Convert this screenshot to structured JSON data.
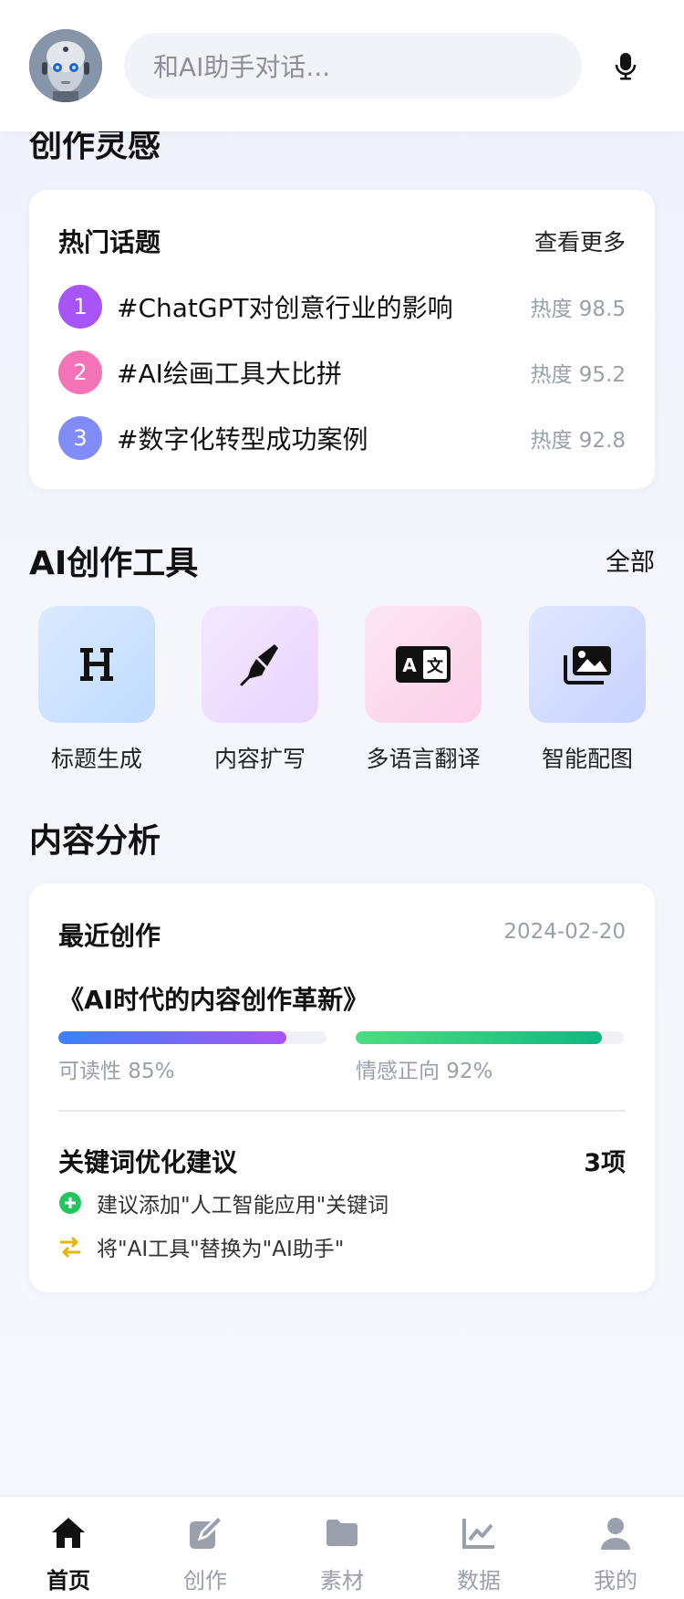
{
  "header": {
    "search_placeholder": "和AI助手对话..."
  },
  "inspiration": {
    "section_title": "创作灵感",
    "hot_topics": {
      "title": "热门话题",
      "more_label": "查看更多",
      "items": [
        {
          "rank": "1",
          "topic": "#ChatGPT对创意行业的影响",
          "heat": "热度 98.5",
          "color": "#a855f7"
        },
        {
          "rank": "2",
          "topic": "#AI绘画工具大比拼",
          "heat": "热度 95.2",
          "color": "#f472b6"
        },
        {
          "rank": "3",
          "topic": "#数字化转型成功案例",
          "heat": "热度 92.8",
          "color": "#818cf8"
        }
      ]
    }
  },
  "tools": {
    "section_title": "AI创作工具",
    "all_label": "全部",
    "items": [
      {
        "label": "标题生成",
        "icon": "heading-icon"
      },
      {
        "label": "内容扩写",
        "icon": "pen-icon"
      },
      {
        "label": "多语言翻译",
        "icon": "translate-icon"
      },
      {
        "label": "智能配图",
        "icon": "images-icon"
      }
    ]
  },
  "analysis": {
    "section_title": "内容分析",
    "recent": {
      "title": "最近创作",
      "date": "2024-02-20",
      "article": "《AI时代的内容创作革新》",
      "readability_label": "可读性 85%",
      "readability_value": 0.85,
      "sentiment_label": "情感正向 92%",
      "sentiment_value": 0.92,
      "keyword_title": "关键词优化建议",
      "keyword_count": "3项",
      "suggestions": [
        {
          "text": "建议添加\"人工智能应用\"关键词",
          "icon": "plus-circle-icon"
        },
        {
          "text": "将\"AI工具\"替换为\"AI助手\"",
          "icon": "swap-icon"
        }
      ]
    }
  },
  "tabbar": {
    "items": [
      {
        "label": "首页",
        "icon": "home-icon",
        "active": true
      },
      {
        "label": "创作",
        "icon": "edit-icon",
        "active": false
      },
      {
        "label": "素材",
        "icon": "folder-icon",
        "active": false
      },
      {
        "label": "数据",
        "icon": "chart-icon",
        "active": false
      },
      {
        "label": "我的",
        "icon": "user-icon",
        "active": false
      }
    ]
  },
  "colors": {
    "accent": "#111111",
    "muted": "#9aa0ab",
    "readability_gradient": [
      "#3b82f6",
      "#a855f7"
    ],
    "sentiment_gradient": [
      "#4ade80",
      "#10b981"
    ],
    "suggest_add": "#22c55e",
    "suggest_swap": "#eab308"
  }
}
